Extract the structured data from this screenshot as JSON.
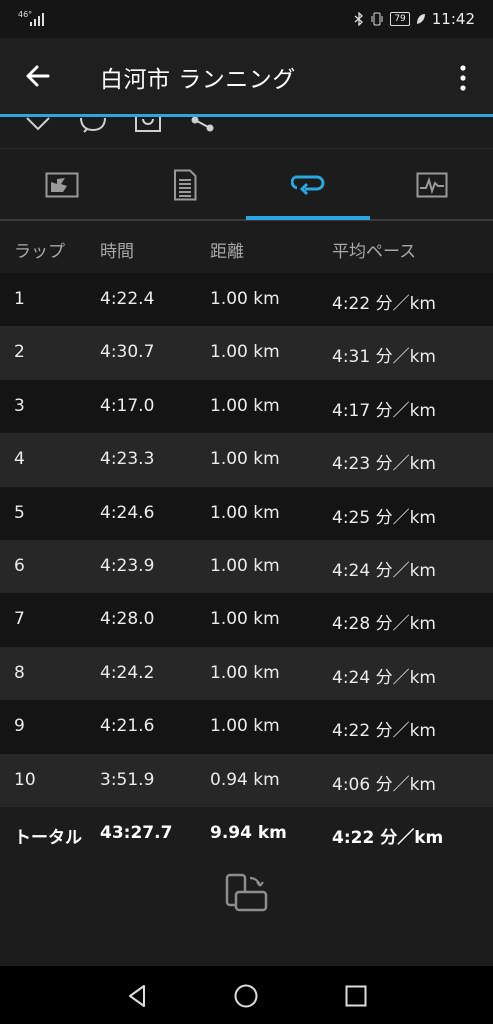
{
  "status": {
    "network": "46°",
    "time": "11:42",
    "battery": "79"
  },
  "appbar": {
    "title": "白河市 ランニング"
  },
  "table": {
    "headers": [
      "ラップ",
      "時間",
      "距離",
      "平均ペース"
    ],
    "rows": [
      [
        "1",
        "4:22.4",
        "1.00 km",
        "4:22 分／km"
      ],
      [
        "2",
        "4:30.7",
        "1.00 km",
        "4:31 分／km"
      ],
      [
        "3",
        "4:17.0",
        "1.00 km",
        "4:17 分／km"
      ],
      [
        "4",
        "4:23.3",
        "1.00 km",
        "4:23 分／km"
      ],
      [
        "5",
        "4:24.6",
        "1.00 km",
        "4:25 分／km"
      ],
      [
        "6",
        "4:23.9",
        "1.00 km",
        "4:24 分／km"
      ],
      [
        "7",
        "4:28.0",
        "1.00 km",
        "4:28 分／km"
      ],
      [
        "8",
        "4:24.2",
        "1.00 km",
        "4:24 分／km"
      ],
      [
        "9",
        "4:21.6",
        "1.00 km",
        "4:22 分／km"
      ],
      [
        "10",
        "3:51.9",
        "0.94 km",
        "4:06 分／km"
      ]
    ],
    "total": [
      "トータル",
      "43:27.7",
      "9.94 km",
      "4:22 分／km"
    ]
  },
  "colors": {
    "accent": "#2aa6e0",
    "background": "#1c1c1c"
  },
  "icons": {
    "tabs": [
      "overview-map-icon",
      "details-list-icon",
      "laps-loop-icon",
      "charts-icon"
    ],
    "actions": [
      "like-icon",
      "comment-icon",
      "camera-icon",
      "share-icon"
    ]
  }
}
